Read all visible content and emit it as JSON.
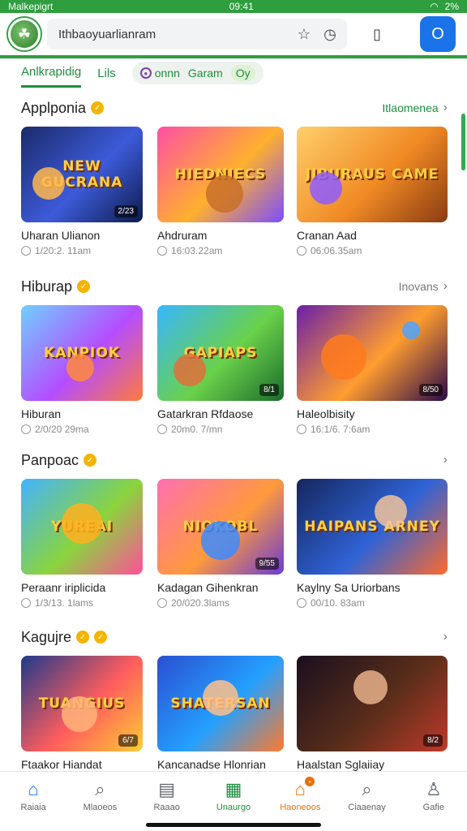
{
  "status": {
    "carrier": "Malkepigrt",
    "time": "09:41",
    "battery": "2%"
  },
  "header": {
    "search_text": "Ithbaoyuarlianram",
    "cta_label": "O"
  },
  "tabs": [
    {
      "label": "Anlkrapidig",
      "active": true
    },
    {
      "label": "Lils",
      "active": false
    }
  ],
  "chips": [
    {
      "label": "onnn"
    },
    {
      "label": "Garam"
    },
    {
      "label": "Oy"
    }
  ],
  "sections": [
    {
      "title": "Applponia",
      "link": "Itlaomenea",
      "cards": [
        {
          "thumb_title": "NEW GUCRANA",
          "name": "Uharan Ulianon",
          "meta": "1/20:2. 11am",
          "corner": "2/23"
        },
        {
          "thumb_title": "HIEDNIECS",
          "name": "Ahdruram",
          "meta": "16:03.22am",
          "corner": ""
        },
        {
          "thumb_title": "JIBURAUS CAME",
          "name": "Cranan Aad",
          "meta": "06:06.35am",
          "corner": ""
        }
      ]
    },
    {
      "title": "Hiburap",
      "link": "Inovans",
      "cards": [
        {
          "thumb_title": "KANPIOK",
          "name": "Hiburan",
          "meta": "2/0/20 29ma",
          "corner": ""
        },
        {
          "thumb_title": "GAPIAPS",
          "name": "Gatarkran Rfdaose",
          "meta": "20m0. 7/mn",
          "corner": "8/1"
        },
        {
          "thumb_title": "",
          "name": "Haleolbisity",
          "meta": "16:1/6. 7:6am",
          "corner": "8/50"
        }
      ]
    },
    {
      "title": "Panpoac",
      "link": "",
      "cards": [
        {
          "thumb_title": "YUREAI",
          "name": "Peraanr iriplicida",
          "meta": "1/3/13. 1lams",
          "corner": ""
        },
        {
          "thumb_title": "NIOKOBL",
          "name": "Kadagan Gihenkran",
          "meta": "20/020.3lams",
          "corner": "9/55"
        },
        {
          "thumb_title": "HAIPANS ARNEY",
          "name": "Kaylny Sa Uriorbans",
          "meta": "00/10. 83am",
          "corner": ""
        }
      ]
    },
    {
      "title": "Kagujre",
      "link": "",
      "cards": [
        {
          "thumb_title": "TUANGIUS",
          "name": "Ftaakor Hiandat",
          "meta": "",
          "corner": "6/7"
        },
        {
          "thumb_title": "SHATERSAN",
          "name": "Kancanadse Hlonrian",
          "meta": "",
          "corner": ""
        },
        {
          "thumb_title": "",
          "name": "Haalstan Sglaiiay",
          "meta": "",
          "corner": "8/2"
        }
      ]
    }
  ],
  "nav": [
    {
      "label": "Raiaia"
    },
    {
      "label": "Mlaoeos"
    },
    {
      "label": "Raaao"
    },
    {
      "label": "Unaurgo"
    },
    {
      "label": "Haoneoos"
    },
    {
      "label": "Ciaaenay"
    },
    {
      "label": "Gafie"
    }
  ]
}
